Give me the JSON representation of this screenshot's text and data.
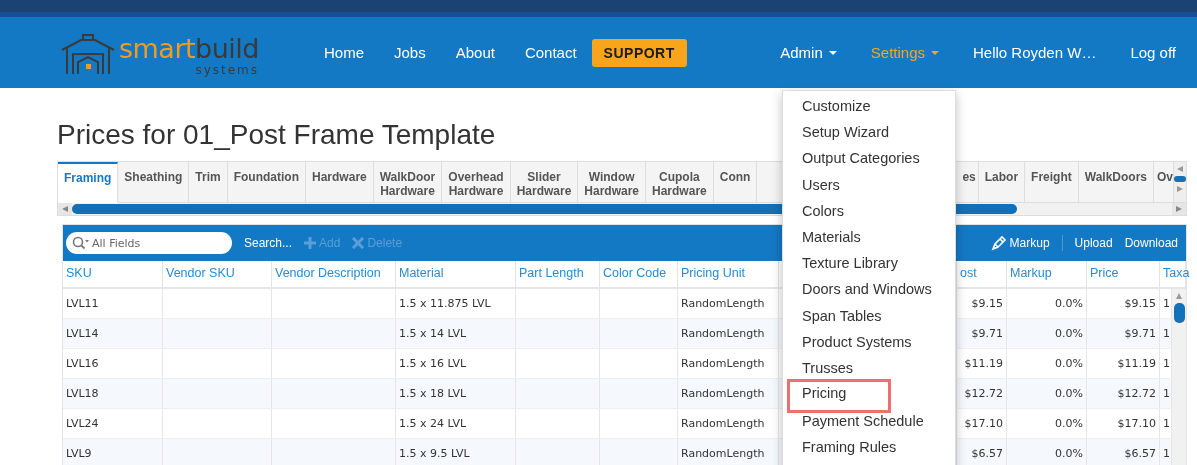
{
  "logo": {
    "primary": "smart",
    "secondary": "build",
    "tagline": "systems"
  },
  "nav": [
    {
      "label": "Home",
      "kind": "link"
    },
    {
      "label": "Jobs",
      "kind": "link"
    },
    {
      "label": "About",
      "kind": "link"
    },
    {
      "label": "Contact",
      "kind": "link"
    },
    {
      "label": "SUPPORT",
      "kind": "button"
    }
  ],
  "nav_right": [
    {
      "label": "Admin",
      "dropdown": true,
      "open": false
    },
    {
      "label": "Settings",
      "dropdown": true,
      "open": true
    },
    {
      "label": "Hello Royden W…",
      "dropdown": false,
      "open": false
    },
    {
      "label": "Log off",
      "dropdown": false,
      "open": false
    }
  ],
  "page_title": "Prices for 01_Post Frame Template",
  "tabs_left": [
    {
      "label": "Framing",
      "selected": true
    },
    {
      "label": "Sheathing",
      "selected": false
    },
    {
      "label": "Trim",
      "selected": false
    },
    {
      "label": "Foundation",
      "selected": false
    },
    {
      "label": "Hardware",
      "selected": false
    },
    {
      "label": "WalkDoor Hardware",
      "selected": false
    },
    {
      "label": "Overhead Hardware",
      "selected": false
    },
    {
      "label": "Slider Hardware",
      "selected": false
    },
    {
      "label": "Window Hardware",
      "selected": false
    },
    {
      "label": "Cupola Hardware",
      "selected": false
    },
    {
      "label": "Conn",
      "selected": false
    }
  ],
  "tabs_right": [
    {
      "label": "es",
      "selected": false
    },
    {
      "label": "Labor",
      "selected": false
    },
    {
      "label": "Freight",
      "selected": false
    },
    {
      "label": "WalkDoors",
      "selected": false
    },
    {
      "label": "Ov",
      "selected": false
    }
  ],
  "toolbar": {
    "search": {
      "placeholder": "All Fields"
    },
    "left_actions": [
      {
        "label": "Search...",
        "kind": "text",
        "disabled": false
      },
      {
        "label": "Add",
        "kind": "add",
        "disabled": true
      },
      {
        "label": "Delete",
        "kind": "delete",
        "disabled": true
      }
    ],
    "right_actions": [
      {
        "label": "Markup",
        "kind": "markup",
        "disabled": false
      },
      {
        "label": "Upload",
        "kind": "text",
        "disabled": false
      },
      {
        "label": "Download",
        "kind": "text",
        "disabled": false
      }
    ]
  },
  "table": {
    "columns": [
      "SKU",
      "Vendor SKU",
      "Vendor Description",
      "Material",
      "Part Length",
      "Color Code",
      "Pricing Unit",
      "ost",
      "Markup",
      "Price",
      "Taxa"
    ],
    "rows": [
      {
        "cells": [
          "LVL11",
          null,
          null,
          "1.5 x 11.875 LVL",
          null,
          null,
          "RandomLength",
          "$9.15",
          "0.0%",
          "$9.15",
          "1"
        ]
      },
      {
        "cells": [
          "LVL14",
          null,
          null,
          "1.5 x 14 LVL",
          null,
          null,
          "RandomLength",
          "$9.71",
          "0.0%",
          "$9.71",
          "1"
        ]
      },
      {
        "cells": [
          "LVL16",
          null,
          null,
          "1.5 x 16 LVL",
          null,
          null,
          "RandomLength",
          "$11.19",
          "0.0%",
          "$11.19",
          "1"
        ]
      },
      {
        "cells": [
          "LVL18",
          null,
          null,
          "1.5 x 18 LVL",
          null,
          null,
          "RandomLength",
          "$12.72",
          "0.0%",
          "$12.72",
          "1"
        ]
      },
      {
        "cells": [
          "LVL24",
          null,
          null,
          "1.5 x 24 LVL",
          null,
          null,
          "RandomLength",
          "$17.10",
          "0.0%",
          "$17.10",
          "1"
        ]
      },
      {
        "cells": [
          "LVL9",
          null,
          null,
          "1.5 x 9.5 LVL",
          null,
          null,
          "RandomLength",
          "$6.57",
          "0.0%",
          "$6.57",
          "1"
        ]
      }
    ]
  },
  "settings_menu": [
    {
      "label": "Customize",
      "highlighted": false
    },
    {
      "label": "Setup Wizard",
      "highlighted": false
    },
    {
      "label": "Output Categories",
      "highlighted": false
    },
    {
      "label": "Users",
      "highlighted": false
    },
    {
      "label": "Colors",
      "highlighted": false
    },
    {
      "label": "Materials",
      "highlighted": false
    },
    {
      "label": "Texture Library",
      "highlighted": false
    },
    {
      "label": "Doors and Windows",
      "highlighted": false
    },
    {
      "label": "Span Tables",
      "highlighted": false
    },
    {
      "label": "Product Systems",
      "highlighted": false
    },
    {
      "label": "Trusses",
      "highlighted": false
    },
    {
      "label": "Pricing",
      "highlighted": true
    },
    {
      "label": "Payment Schedule",
      "highlighted": false
    },
    {
      "label": "Framing Rules",
      "highlighted": false
    }
  ]
}
